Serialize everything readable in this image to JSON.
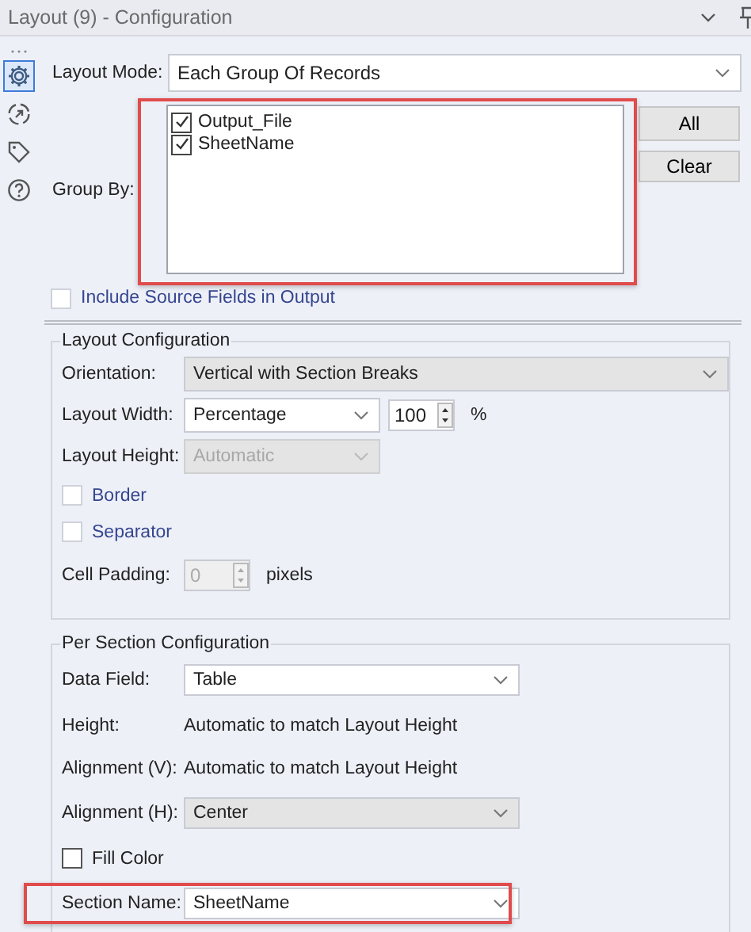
{
  "window": {
    "title": "Layout (9) - Configuration"
  },
  "sidebar": {
    "items": [
      {
        "kind": "gear",
        "selected": true
      },
      {
        "kind": "connect",
        "selected": false
      },
      {
        "kind": "tag",
        "selected": false
      },
      {
        "kind": "help",
        "selected": false
      }
    ]
  },
  "layout_mode": {
    "label": "Layout Mode:",
    "value": "Each Group Of Records"
  },
  "group_by": {
    "label": "Group By:",
    "highlighted": true,
    "fields": [
      {
        "name": "Output_File",
        "checked": true
      },
      {
        "name": "SheetName",
        "checked": true
      }
    ],
    "buttons": [
      "All",
      "Clear"
    ]
  },
  "include_source_fields": {
    "label": "Include Source Fields in Output",
    "checked": false
  },
  "layout_configuration": {
    "title": "Layout Configuration",
    "rows": [
      {
        "kind": "wide-select",
        "label": "Orientation:",
        "value": "Vertical with Section Breaks",
        "disabled": false,
        "shaded": true
      },
      {
        "kind": "select-spin",
        "label": "Layout Width:",
        "value": "Percentage",
        "number": "100",
        "unit": "%"
      },
      {
        "kind": "select",
        "label": "Layout Height:",
        "value": "Automatic",
        "disabled": true,
        "shaded": true
      },
      {
        "kind": "checkbox",
        "label": "Border",
        "checked": false,
        "accent": true
      },
      {
        "kind": "checkbox",
        "label": "Separator",
        "checked": false,
        "accent": true
      },
      {
        "kind": "spin",
        "label": "Cell Padding:",
        "number": "0",
        "unit": "pixels",
        "disabled": true
      }
    ]
  },
  "per_section_configuration": {
    "title": "Per Section Configuration",
    "rows": [
      {
        "kind": "long-select",
        "label": "Data Field:",
        "value": "Table",
        "disabled": false,
        "shaded": false
      },
      {
        "kind": "text",
        "label": "Height:",
        "value": "Automatic to match Layout Height"
      },
      {
        "kind": "text",
        "label": "Alignment (V):",
        "value": "Automatic to match Layout Height"
      },
      {
        "kind": "long-select",
        "label": "Alignment (H):",
        "value": "Center",
        "disabled": false,
        "shaded": true
      },
      {
        "kind": "checkbox",
        "label": "Fill Color",
        "checked": false,
        "accent": false
      },
      {
        "kind": "long-select",
        "label": "Section Name:",
        "value": "SheetName",
        "disabled": false,
        "shaded": false,
        "highlighted": true
      }
    ]
  }
}
